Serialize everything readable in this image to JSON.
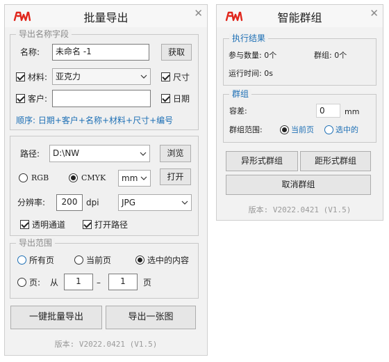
{
  "export_window": {
    "title": "批量导出",
    "field_group": {
      "title": "导出名称字段",
      "name_label": "名称:",
      "name_value": "未命名 -1",
      "fetch_button": "获取",
      "material_label": "材料:",
      "material_value": "亚克力",
      "size_label": "尺寸",
      "customer_label": "客户:",
      "customer_value": "",
      "date_label": "日期",
      "order_text": "顺序: 日期+客户+名称+材料+尺寸+编号"
    },
    "path_group": {
      "path_label": "路径:",
      "path_value": "D:\\NW",
      "browse_button": "浏览",
      "rgb_label": "RGB",
      "cmyk_label": "CMYK",
      "unit_value": "mm",
      "open_button": "打开",
      "dpi_label": "分辨率:",
      "dpi_value": "200",
      "dpi_unit": "dpi",
      "format_value": "JPG",
      "transparent_label": "透明通道",
      "open_path_label": "打开路径"
    },
    "range_group": {
      "title": "导出范围",
      "all_pages": "所有页",
      "current_page": "当前页",
      "selected_content": "选中的内容",
      "pages_label": "页:",
      "from_label": "从",
      "from_value": "1",
      "dash": "–",
      "to_value": "1",
      "page_unit": "页"
    },
    "batch_export_button": "一键批量导出",
    "export_one_button": "导出一张图",
    "version": "版本: V2022.0421 (V1.5)"
  },
  "group_window": {
    "title": "智能群组",
    "result_group": {
      "title": "执行结果",
      "count_label": "参与数量: 0个",
      "groups_label": "群组: 0个",
      "time_label": "运行时间: 0s"
    },
    "group_settings": {
      "title": "群组",
      "tolerance_label": "容差:",
      "tolerance_value": "0",
      "tolerance_unit": "mm",
      "range_label": "群组范围:",
      "current_page": "当前页",
      "selected": "选中的"
    },
    "irregular_button": "异形式群组",
    "rect_button": "距形式群组",
    "cancel_button": "取消群组",
    "version": "版本: V2022.0421 (V1.5)"
  },
  "colors": {
    "accent": "#1d6fb5",
    "logo_red": "#e0261c",
    "window_bg": "#f2f2f2"
  }
}
